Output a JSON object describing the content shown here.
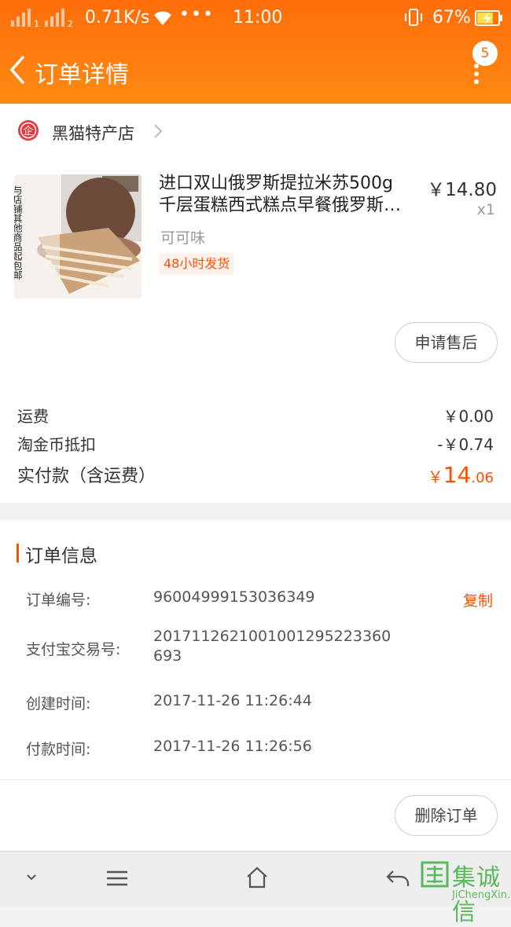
{
  "status_bar": {
    "network_speed": "0.71K/s",
    "time": "11:00",
    "battery": "67%"
  },
  "header": {
    "title": "订单详情",
    "badge_count": "5"
  },
  "shop": {
    "name": "黑猫特产店",
    "icon_glyph": "企"
  },
  "product": {
    "title_line1": "进口双山俄罗斯提拉米苏500g",
    "title_line2": "千层蛋糕西式糕点早餐俄罗斯…",
    "price": "￥14.80",
    "quantity": "x1",
    "variant": "可可味",
    "shipping_tag": "48小时发货",
    "image_overlay_text": "与店铺其他商品起包邮"
  },
  "actions": {
    "after_sale": "申请售后",
    "delete_order": "删除订单"
  },
  "fees": {
    "shipping_label": "运费",
    "shipping_value": "￥0.00",
    "coin_label": "淘金币抵扣",
    "coin_value": "-￥0.74",
    "paid_label": "实付款（含运费）",
    "paid_currency": "￥",
    "paid_int": "14",
    "paid_dec": ".06"
  },
  "order_info": {
    "section_title": "订单信息",
    "order_no_label": "订单编号:",
    "order_no": "96004999153036349",
    "copy": "复制",
    "alipay_label": "支付宝交易号:",
    "alipay_line1": "2017112621001001295223360",
    "alipay_line2": "693",
    "created_label": "创建时间:",
    "created": "2017-11-26 11:26:44",
    "paid_label": "付款时间:",
    "paid": "2017-11-26 11:26:56"
  },
  "watermark": {
    "text": "集诚信",
    "sub": "JiChengXin.com"
  },
  "colors": {
    "header_orange": "#ff6d0a",
    "accent": "#ff5000"
  }
}
